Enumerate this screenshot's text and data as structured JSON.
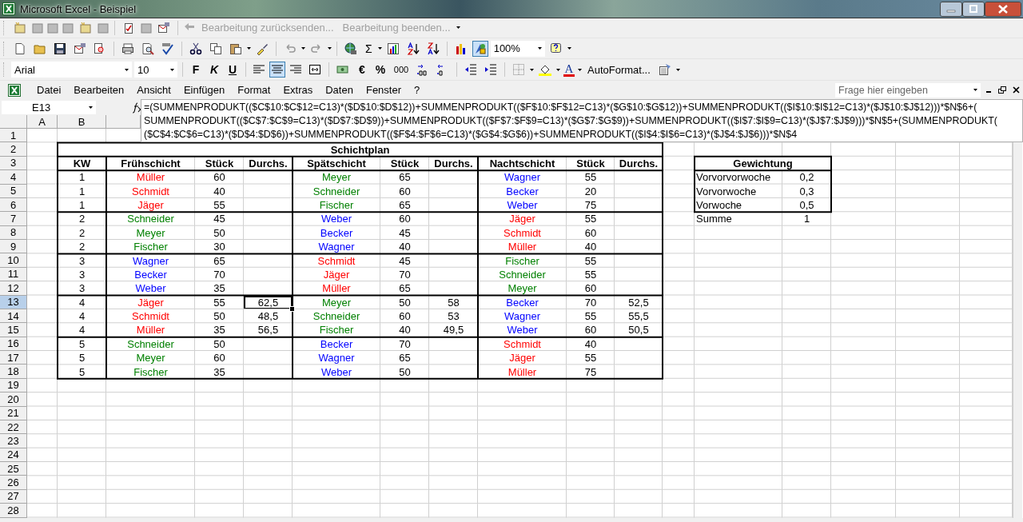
{
  "window": {
    "title": "Microsoft Excel - Beispiel"
  },
  "review_toolbar": {
    "items": [
      {
        "label": "Bearbeitung zurücksenden...",
        "disabled": true
      },
      {
        "label": "Bearbeitung beenden...",
        "disabled": true
      }
    ]
  },
  "standard_toolbar": {
    "sigma": "Σ",
    "drawing_pressed": true,
    "zoom": "100%"
  },
  "formatting_toolbar": {
    "font": "Arial",
    "size": "10",
    "bold": "F",
    "italic": "K",
    "underline": "U",
    "align": [
      {
        "selected": false
      },
      {
        "selected": true
      },
      {
        "selected": false
      }
    ],
    "currency": "€",
    "percent": "%",
    "thousands": "000",
    "font_color_letter": "A",
    "autoformat": "AutoFormat..."
  },
  "menu": [
    "Datei",
    "Bearbeiten",
    "Ansicht",
    "Einfügen",
    "Format",
    "Extras",
    "Daten",
    "Fenster",
    "?"
  ],
  "help_box": {
    "placeholder": "Frage hier eingeben"
  },
  "name_box": "E13",
  "formula_lines": [
    "=(SUMMENPRODUKT(($C$10:$C$12=C13)*($D$10:$D$12))+SUMMENPRODUKT(($F$10:$F$12=C13)*($G$10:$G$12))+SUMMENPRODUKT(($I$10:$I$12=C13)*($J$10:$J$12)))*$N$6+(",
    "SUMMENPRODUKT(($C$7:$C$9=C13)*($D$7:$D$9))+SUMMENPRODUKT(($F$7:$F$9=C13)*($G$7:$G$9))+SUMMENPRODUKT(($I$7:$I$9=C13)*($J$7:$J$9)))*$N$5+(SUMMENPRODUKT(",
    "($C$4:$C$6=C13)*($D$4:$D$6))+SUMMENPRODUKT(($F$4:$F$6=C13)*($G$4:$G$6))+SUMMENPRODUKT(($I$4:$I$6=C13)*($J$4:$J$6)))*$N$4"
  ],
  "sheet": {
    "columns": [
      "A",
      "B"
    ],
    "rows": [
      {
        "number": "1",
        "selected": false
      },
      {
        "number": "2",
        "selected": false
      },
      {
        "number": "3",
        "selected": false
      },
      {
        "number": "4",
        "selected": false
      },
      {
        "number": "5",
        "selected": false
      },
      {
        "number": "6",
        "selected": false
      },
      {
        "number": "7",
        "selected": false
      },
      {
        "number": "8",
        "selected": false
      },
      {
        "number": "9",
        "selected": false
      },
      {
        "number": "10",
        "selected": false
      },
      {
        "number": "11",
        "selected": false
      },
      {
        "number": "12",
        "selected": false
      },
      {
        "number": "13",
        "selected": true
      },
      {
        "number": "14",
        "selected": false
      },
      {
        "number": "15",
        "selected": false
      },
      {
        "number": "16",
        "selected": false
      },
      {
        "number": "17",
        "selected": false
      },
      {
        "number": "18",
        "selected": false
      },
      {
        "number": "19",
        "selected": false
      },
      {
        "number": "20",
        "selected": false
      },
      {
        "number": "21",
        "selected": false
      },
      {
        "number": "22",
        "selected": false
      },
      {
        "number": "23",
        "selected": false
      },
      {
        "number": "24",
        "selected": false
      },
      {
        "number": "25",
        "selected": false
      },
      {
        "number": "26",
        "selected": false
      },
      {
        "number": "27",
        "selected": false
      },
      {
        "number": "28",
        "selected": false
      }
    ]
  },
  "schichtplan": {
    "title": "Schichtplan",
    "headers": [
      "KW",
      "Frühschicht",
      "Stück",
      "Durchs.",
      "Spätschicht",
      "Stück",
      "Durchs.",
      "Nachtschicht",
      "Stück",
      "Durchs."
    ],
    "rows": [
      {
        "kw": "1",
        "shifts": [
          {
            "name": "Müller",
            "color": "#ff0000",
            "count": "60",
            "selected": false
          },
          {
            "name": "Meyer",
            "color": "#008000",
            "count": "65",
            "selected": false
          },
          {
            "name": "Wagner",
            "color": "#0000ff",
            "count": "55",
            "selected": false
          }
        ]
      },
      {
        "kw": "1",
        "shifts": [
          {
            "name": "Schmidt",
            "color": "#ff0000",
            "count": "40",
            "selected": false
          },
          {
            "name": "Schneider",
            "color": "#008000",
            "count": "60",
            "selected": false
          },
          {
            "name": "Becker",
            "color": "#0000ff",
            "count": "20",
            "selected": false
          }
        ]
      },
      {
        "kw": "1",
        "shifts": [
          {
            "name": "Jäger",
            "color": "#ff0000",
            "count": "55",
            "selected": false
          },
          {
            "name": "Fischer",
            "color": "#008000",
            "count": "65",
            "selected": false
          },
          {
            "name": "Weber",
            "color": "#0000ff",
            "count": "75",
            "selected": false
          }
        ]
      },
      {
        "kw": "2",
        "shifts": [
          {
            "name": "Schneider",
            "color": "#008000",
            "count": "45",
            "selected": false
          },
          {
            "name": "Weber",
            "color": "#0000ff",
            "count": "60",
            "selected": false
          },
          {
            "name": "Jäger",
            "color": "#ff0000",
            "count": "55",
            "selected": false
          }
        ]
      },
      {
        "kw": "2",
        "shifts": [
          {
            "name": "Meyer",
            "color": "#008000",
            "count": "50",
            "selected": false
          },
          {
            "name": "Becker",
            "color": "#0000ff",
            "count": "45",
            "selected": false
          },
          {
            "name": "Schmidt",
            "color": "#ff0000",
            "count": "60",
            "selected": false
          }
        ]
      },
      {
        "kw": "2",
        "shifts": [
          {
            "name": "Fischer",
            "color": "#008000",
            "count": "30",
            "selected": false
          },
          {
            "name": "Wagner",
            "color": "#0000ff",
            "count": "40",
            "selected": false
          },
          {
            "name": "Müller",
            "color": "#ff0000",
            "count": "40",
            "selected": false
          }
        ]
      },
      {
        "kw": "3",
        "shifts": [
          {
            "name": "Wagner",
            "color": "#0000ff",
            "count": "65",
            "selected": false
          },
          {
            "name": "Schmidt",
            "color": "#ff0000",
            "count": "45",
            "selected": false
          },
          {
            "name": "Fischer",
            "color": "#008000",
            "count": "55",
            "selected": false
          }
        ]
      },
      {
        "kw": "3",
        "shifts": [
          {
            "name": "Becker",
            "color": "#0000ff",
            "count": "70",
            "selected": false
          },
          {
            "name": "Jäger",
            "color": "#ff0000",
            "count": "70",
            "selected": false
          },
          {
            "name": "Schneider",
            "color": "#008000",
            "count": "55",
            "selected": false
          }
        ]
      },
      {
        "kw": "3",
        "shifts": [
          {
            "name": "Weber",
            "color": "#0000ff",
            "count": "35",
            "selected": false
          },
          {
            "name": "Müller",
            "color": "#ff0000",
            "count": "65",
            "selected": false
          },
          {
            "name": "Meyer",
            "color": "#008000",
            "count": "60",
            "selected": false
          }
        ]
      },
      {
        "kw": "4",
        "shifts": [
          {
            "name": "Jäger",
            "color": "#ff0000",
            "count": "55",
            "avg": "62,5",
            "selected": true
          },
          {
            "name": "Meyer",
            "color": "#008000",
            "count": "50",
            "avg": "58",
            "selected": false
          },
          {
            "name": "Becker",
            "color": "#0000ff",
            "count": "70",
            "avg": "52,5",
            "selected": false
          }
        ]
      },
      {
        "kw": "4",
        "shifts": [
          {
            "name": "Schmidt",
            "color": "#ff0000",
            "count": "50",
            "avg": "48,5",
            "selected": false
          },
          {
            "name": "Schneider",
            "color": "#008000",
            "count": "60",
            "avg": "53",
            "selected": false
          },
          {
            "name": "Wagner",
            "color": "#0000ff",
            "count": "55",
            "avg": "55,5",
            "selected": false
          }
        ]
      },
      {
        "kw": "4",
        "shifts": [
          {
            "name": "Müller",
            "color": "#ff0000",
            "count": "35",
            "avg": "56,5",
            "selected": false
          },
          {
            "name": "Fischer",
            "color": "#008000",
            "count": "40",
            "avg": "49,5",
            "selected": false
          },
          {
            "name": "Weber",
            "color": "#0000ff",
            "count": "60",
            "avg": "50,5",
            "selected": false
          }
        ]
      },
      {
        "kw": "5",
        "shifts": [
          {
            "name": "Schneider",
            "color": "#008000",
            "count": "50",
            "selected": false
          },
          {
            "name": "Becker",
            "color": "#0000ff",
            "count": "70",
            "selected": false
          },
          {
            "name": "Schmidt",
            "color": "#ff0000",
            "count": "40",
            "selected": false
          }
        ]
      },
      {
        "kw": "5",
        "shifts": [
          {
            "name": "Meyer",
            "color": "#008000",
            "count": "60",
            "selected": false
          },
          {
            "name": "Wagner",
            "color": "#0000ff",
            "count": "65",
            "selected": false
          },
          {
            "name": "Jäger",
            "color": "#ff0000",
            "count": "55",
            "selected": false
          }
        ]
      },
      {
        "kw": "5",
        "shifts": [
          {
            "name": "Fischer",
            "color": "#008000",
            "count": "35",
            "selected": false
          },
          {
            "name": "Weber",
            "color": "#0000ff",
            "count": "50",
            "selected": false
          },
          {
            "name": "Müller",
            "color": "#ff0000",
            "count": "75",
            "selected": false
          }
        ]
      }
    ]
  },
  "gewichtung": {
    "title": "Gewichtung",
    "rows": [
      {
        "label": "Vorvorvorwoche",
        "value": "0,2"
      },
      {
        "label": "Vorvorwoche",
        "value": "0,3"
      },
      {
        "label": "Vorwoche",
        "value": "0,5"
      }
    ],
    "sum": {
      "label": "Summe",
      "value": "1"
    }
  }
}
